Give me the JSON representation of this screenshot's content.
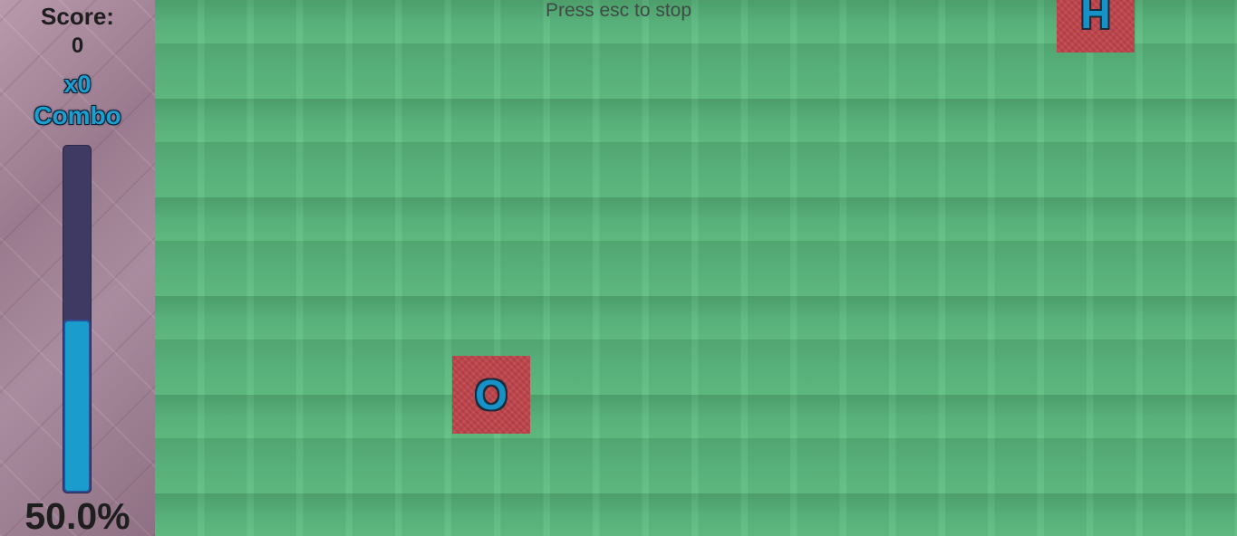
{
  "sidebar": {
    "score_label": "Score:",
    "score_value": "0",
    "combo_multiplier": "x0",
    "combo_label": "Combo",
    "meter_fraction": 0.5,
    "percent_text": "50.0%"
  },
  "field": {
    "hint": "Press esc to stop",
    "tiles": [
      {
        "letter": "O"
      },
      {
        "letter": "H"
      }
    ]
  },
  "colors": {
    "field_green": "#5ab57c",
    "tile_red": "#c0464d",
    "letter_blue": "#1592c8",
    "meter_fill": "#1a9ccc",
    "meter_track": "#3e3a63",
    "sidebar_mauve": "#9e7f93"
  }
}
